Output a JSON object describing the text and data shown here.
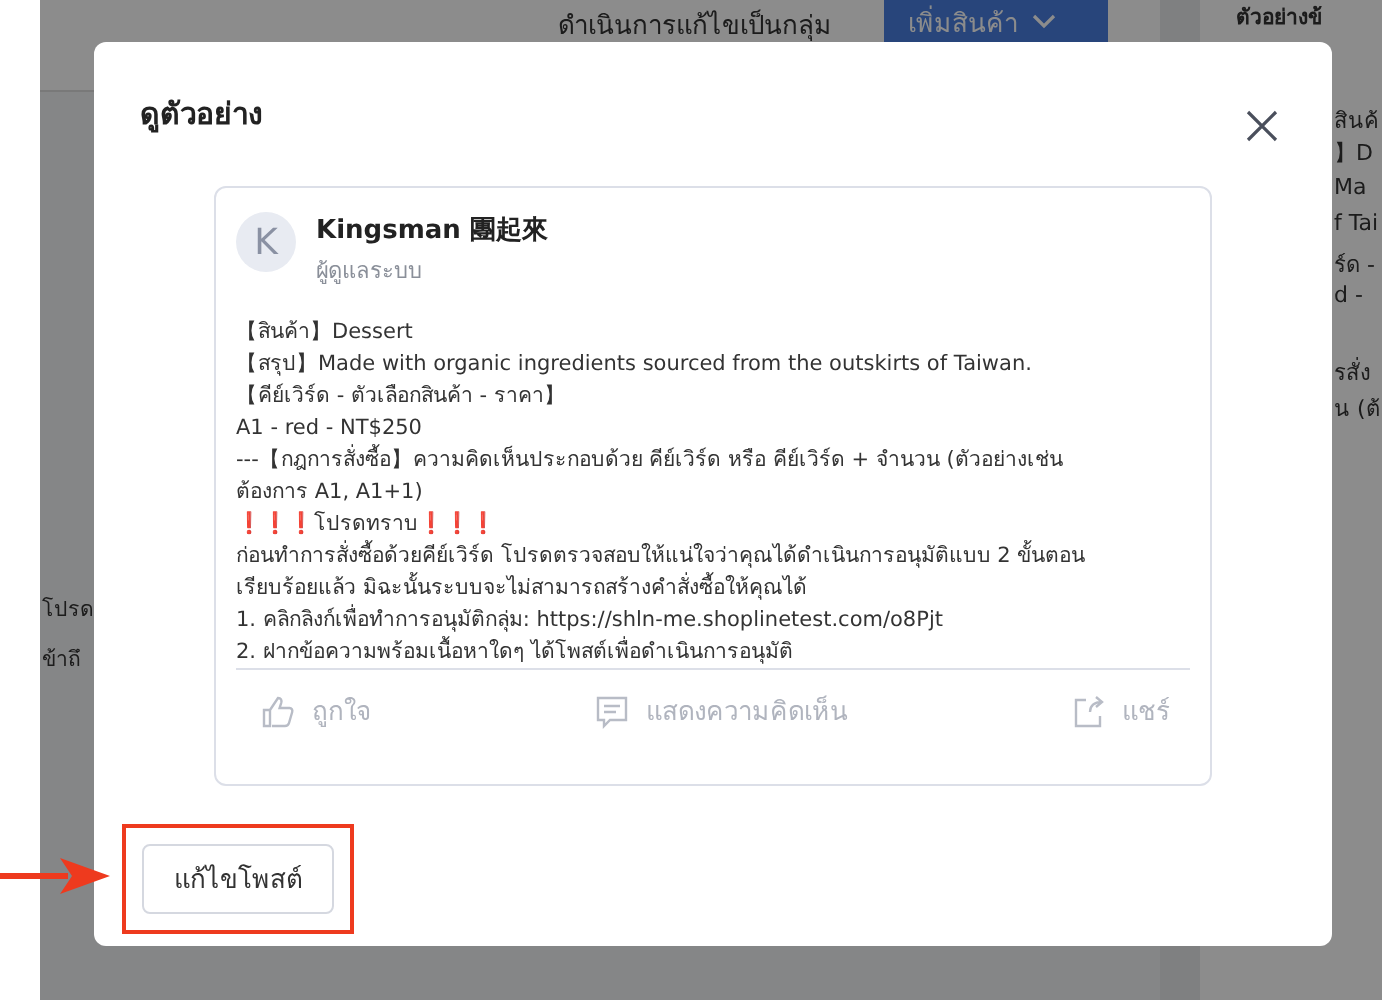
{
  "background": {
    "bulk_edit_label": "ดำเนินการแก้ไขเป็นกลุ่ม",
    "add_product_button": "เพิ่มสินค้า",
    "side_panel_title": "ตัวอย่างข้",
    "side_panel_groups": [
      [
        "สินค้",
        "】D",
        "Ma",
        "f Tai",
        "ร์ด -",
        "d -"
      ],
      [
        "รสั่ง",
        "น (ต้"
      ]
    ],
    "left_fragments": [
      "โปรด",
      "ข้าถึ"
    ]
  },
  "modal": {
    "title": "ดูตัวอย่าง",
    "post": {
      "author": "Kingsman 團起來",
      "avatar_letter": "K",
      "role": "ผู้ดูแลระบบ",
      "body": [
        "【สินค้า】Dessert",
        "【สรุป】Made with organic ingredients sourced from the outskirts of Taiwan.",
        "【คีย์เวิร์ด - ตัวเลือกสินค้า - ราคา】",
        "A1 - red - NT$250",
        "---【กฎการสั่งซื้อ】ความคิดเห็นประกอบด้วย คีย์เวิร์ด หรือ  คีย์เวิร์ด + จำนวน (ตัวอย่างเช่น ต้องการ A1, A1+1)",
        "❗❗❗โปรดทราบ❗❗❗",
        "ก่อนทำการสั่งซื้อด้วยคีย์เวิร์ด โปรดตรวจสอบให้แน่ใจว่าคุณได้ดำเนินการอนุมัติแบบ 2 ขั้นตอน เรียบร้อยแล้ว มิฉะนั้นระบบจะไม่สามารถสร้างคำสั่งซื้อให้คุณได้",
        "1. คลิกลิงก์เพื่อทำการอนุมัติกลุ่ม: https://shln-me.shoplinetest.com/o8Pjt",
        "2. ฝากข้อความพร้อมเนื้อหาใดๆ ได้โพสต์เพื่อดำเนินการอนุมัติ"
      ],
      "actions": [
        {
          "kind": "like",
          "label": "ถูกใจ"
        },
        {
          "kind": "comment",
          "label": "แสดงความคิดเห็น"
        },
        {
          "kind": "share",
          "label": "แชร์"
        }
      ]
    },
    "edit_button": "แก้ไขโพสต์"
  }
}
